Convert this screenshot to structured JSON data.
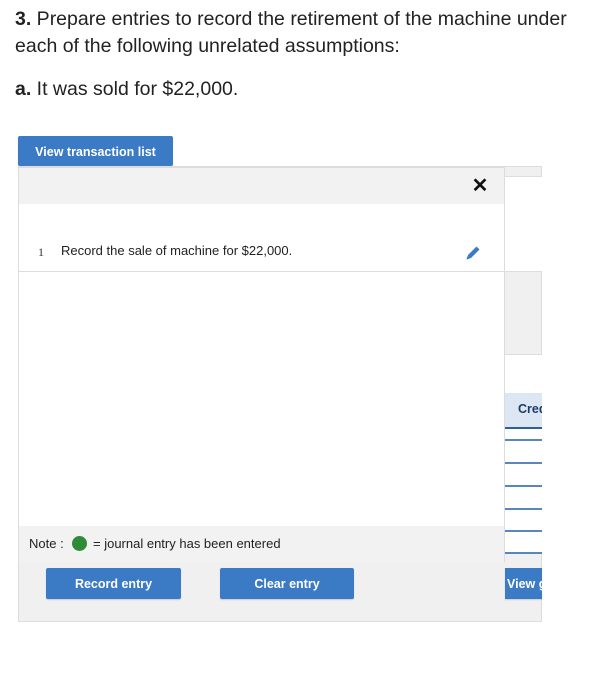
{
  "question": {
    "number": "3.",
    "text": " Prepare entries to record the retirement of the machine under each of the following unrelated assumptions:"
  },
  "sub_question": {
    "letter": "a.",
    "text": " It was sold for $22,000."
  },
  "buttons": {
    "view_transaction_list": "View transaction list",
    "record_entry": "Record entry",
    "clear_entry": "Clear entry",
    "view_general_journal": "View g"
  },
  "popup": {
    "close_glyph": "✕",
    "transactions": [
      {
        "number": "1",
        "description": "Record the sale of machine for $22,000."
      }
    ],
    "note": {
      "label": "Note :",
      "text": "= journal entry has been entered",
      "dot_color": "#2e8b3a"
    }
  },
  "journal": {
    "credit_header": "Cred"
  },
  "colors": {
    "accent": "#3b7bc6",
    "edit_icon": "#3b7bc6"
  }
}
